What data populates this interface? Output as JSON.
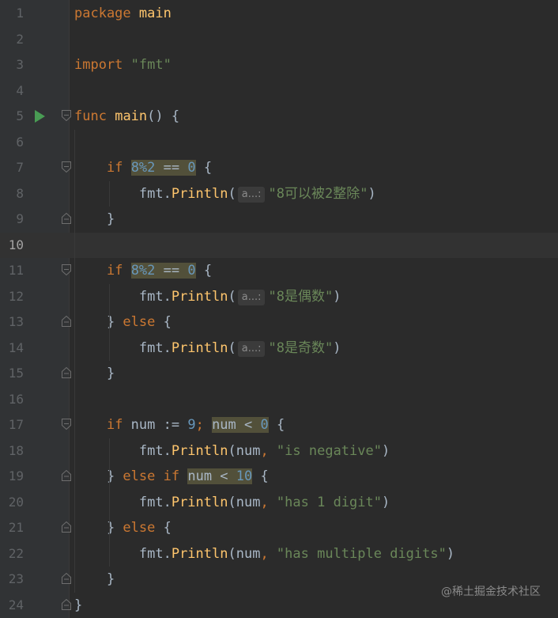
{
  "editor": {
    "lines": [
      {
        "num": "1",
        "tokens": [
          {
            "t": "package",
            "c": "kw"
          },
          {
            "t": " main",
            "c": "fn"
          }
        ]
      },
      {
        "num": "2",
        "tokens": []
      },
      {
        "num": "3",
        "tokens": [
          {
            "t": "import",
            "c": "kw"
          },
          {
            "t": " "
          },
          {
            "t": "\"fmt\"",
            "c": "str"
          }
        ]
      },
      {
        "num": "4",
        "tokens": []
      },
      {
        "num": "5",
        "run": true,
        "fold": "open",
        "tokens": [
          {
            "t": "func",
            "c": "kw"
          },
          {
            "t": " "
          },
          {
            "t": "main",
            "c": "fn"
          },
          {
            "t": "() {"
          }
        ]
      },
      {
        "num": "6",
        "tokens": []
      },
      {
        "num": "7",
        "fold": "open",
        "tokens": [
          {
            "t": "    "
          },
          {
            "t": "if",
            "c": "kw"
          },
          {
            "t": " "
          },
          {
            "t": "8%2",
            "c": "num hl"
          },
          {
            "t": " == ",
            "c": "hl"
          },
          {
            "t": "0",
            "c": "num hl"
          },
          {
            "t": " {"
          }
        ]
      },
      {
        "num": "8",
        "tokens": [
          {
            "t": "        fmt."
          },
          {
            "t": "Println",
            "c": "fn"
          },
          {
            "t": "("
          },
          {
            "hint": "a...:"
          },
          {
            "t": "\"8可以被2整除\"",
            "c": "str"
          },
          {
            "t": ")"
          }
        ]
      },
      {
        "num": "9",
        "fold": "close",
        "tokens": [
          {
            "t": "    }"
          }
        ]
      },
      {
        "num": "10",
        "current": true,
        "tokens": []
      },
      {
        "num": "11",
        "fold": "open",
        "tokens": [
          {
            "t": "    "
          },
          {
            "t": "if",
            "c": "kw"
          },
          {
            "t": " "
          },
          {
            "t": "8%2",
            "c": "num hl"
          },
          {
            "t": " == ",
            "c": "hl"
          },
          {
            "t": "0",
            "c": "num hl"
          },
          {
            "t": " {"
          }
        ]
      },
      {
        "num": "12",
        "tokens": [
          {
            "t": "        fmt."
          },
          {
            "t": "Println",
            "c": "fn"
          },
          {
            "t": "("
          },
          {
            "hint": "a...:"
          },
          {
            "t": "\"8是偶数\"",
            "c": "str"
          },
          {
            "t": ")"
          }
        ]
      },
      {
        "num": "13",
        "fold": "close",
        "tokens": [
          {
            "t": "    } "
          },
          {
            "t": "else",
            "c": "kw"
          },
          {
            "t": " {"
          }
        ]
      },
      {
        "num": "14",
        "tokens": [
          {
            "t": "        fmt."
          },
          {
            "t": "Println",
            "c": "fn"
          },
          {
            "t": "("
          },
          {
            "hint": "a...:"
          },
          {
            "t": "\"8是奇数\"",
            "c": "str"
          },
          {
            "t": ")"
          }
        ]
      },
      {
        "num": "15",
        "fold": "close",
        "tokens": [
          {
            "t": "    }"
          }
        ]
      },
      {
        "num": "16",
        "tokens": []
      },
      {
        "num": "17",
        "fold": "open",
        "tokens": [
          {
            "t": "    "
          },
          {
            "t": "if",
            "c": "kw"
          },
          {
            "t": " num := "
          },
          {
            "t": "9",
            "c": "num"
          },
          {
            "t": "; ",
            "c": "kw"
          },
          {
            "t": "num < ",
            "c": "hl"
          },
          {
            "t": "0",
            "c": "num hl"
          },
          {
            "t": " {"
          }
        ]
      },
      {
        "num": "18",
        "tokens": [
          {
            "t": "        fmt."
          },
          {
            "t": "Println",
            "c": "fn"
          },
          {
            "t": "(num"
          },
          {
            "t": ", ",
            "c": "kw"
          },
          {
            "t": "\"is negative\"",
            "c": "str"
          },
          {
            "t": ")"
          }
        ]
      },
      {
        "num": "19",
        "fold": "close",
        "tokens": [
          {
            "t": "    } "
          },
          {
            "t": "else",
            "c": "kw"
          },
          {
            "t": " "
          },
          {
            "t": "if",
            "c": "kw"
          },
          {
            "t": " "
          },
          {
            "t": "num < ",
            "c": "hl"
          },
          {
            "t": "10",
            "c": "num hl"
          },
          {
            "t": " {"
          }
        ]
      },
      {
        "num": "20",
        "tokens": [
          {
            "t": "        fmt."
          },
          {
            "t": "Println",
            "c": "fn"
          },
          {
            "t": "(num"
          },
          {
            "t": ", ",
            "c": "kw"
          },
          {
            "t": "\"has 1 digit\"",
            "c": "str"
          },
          {
            "t": ")"
          }
        ]
      },
      {
        "num": "21",
        "fold": "close",
        "tokens": [
          {
            "t": "    } "
          },
          {
            "t": "else",
            "c": "kw"
          },
          {
            "t": " {"
          }
        ]
      },
      {
        "num": "22",
        "tokens": [
          {
            "t": "        fmt."
          },
          {
            "t": "Println",
            "c": "fn"
          },
          {
            "t": "(num"
          },
          {
            "t": ", ",
            "c": "kw"
          },
          {
            "t": "\"has multiple digits\"",
            "c": "str"
          },
          {
            "t": ")"
          }
        ]
      },
      {
        "num": "23",
        "fold": "close",
        "tokens": [
          {
            "t": "    }"
          }
        ]
      },
      {
        "num": "24",
        "fold": "close",
        "tokens": [
          {
            "t": "}"
          }
        ]
      }
    ]
  },
  "watermark": "@稀土掘金技术社区",
  "colors": {
    "background": "#2b2b2b",
    "gutter": "#313335",
    "keyword": "#cc7832",
    "function": "#ffc66d",
    "string": "#6a8759",
    "number": "#6897bb",
    "text": "#a9b7c6",
    "highlight": "#52503a",
    "run_icon": "#499c54"
  }
}
